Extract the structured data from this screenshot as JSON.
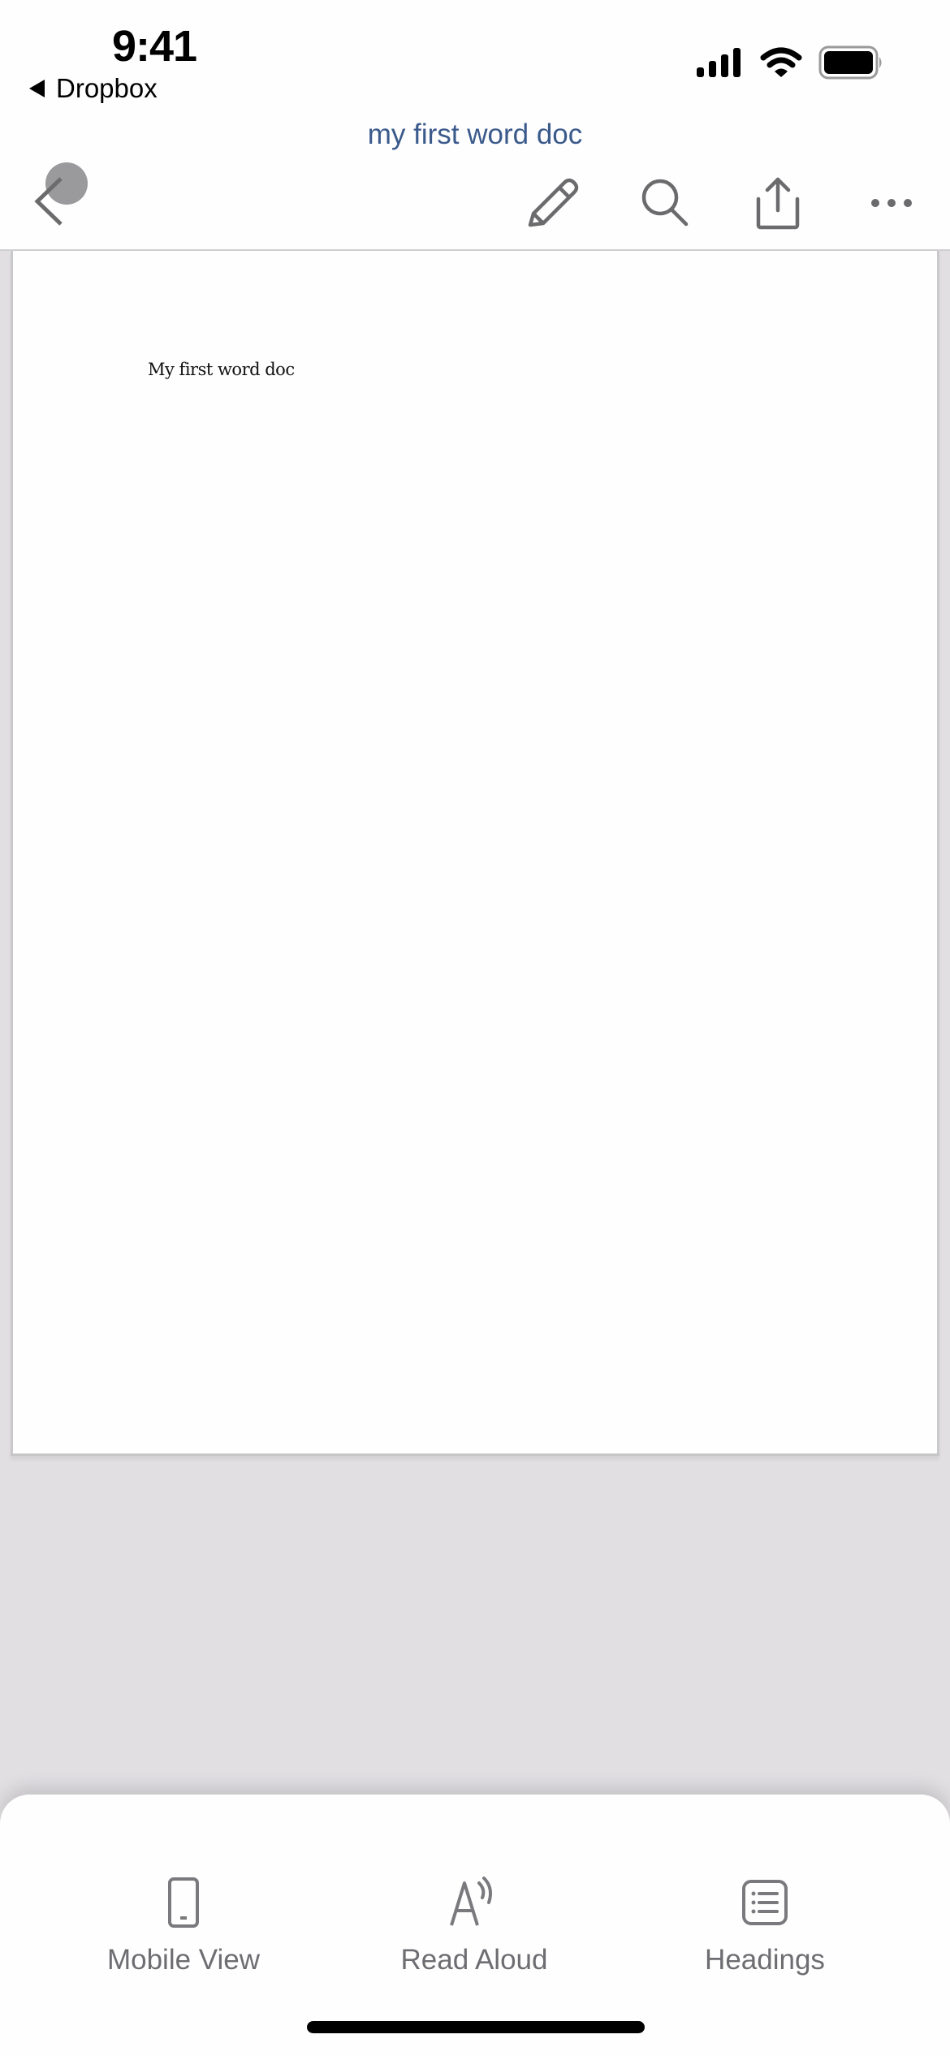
{
  "status_bar": {
    "time": "9:41",
    "back_app_label": "Dropbox",
    "icons": [
      "cellular-signal-icon",
      "wifi-icon",
      "battery-icon"
    ]
  },
  "header": {
    "document_title": "my first word doc",
    "title_color": "#3b5a8c"
  },
  "toolbar": {
    "items": [
      {
        "name": "back",
        "icon": "chevron-left-icon"
      },
      {
        "name": "edit",
        "icon": "pencil-icon"
      },
      {
        "name": "search",
        "icon": "search-icon"
      },
      {
        "name": "share",
        "icon": "share-icon"
      },
      {
        "name": "more",
        "icon": "more-icon"
      }
    ]
  },
  "document": {
    "body_text": "My first word doc"
  },
  "bottom_sheet": {
    "items": [
      {
        "label": "Mobile View",
        "icon": "phone-icon"
      },
      {
        "label": "Read Aloud",
        "icon": "read-aloud-icon"
      },
      {
        "label": "Headings",
        "icon": "headings-list-icon"
      }
    ]
  }
}
